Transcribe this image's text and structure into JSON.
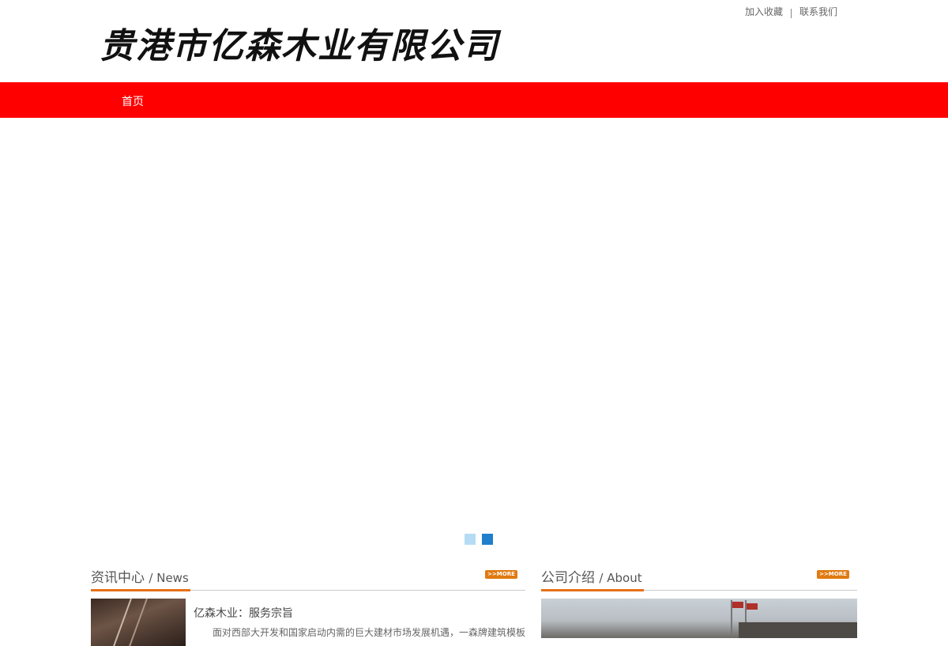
{
  "header": {
    "logo_text": "贵港市亿森木业有限公司",
    "links": {
      "favorite": "加入收藏",
      "contact": "联系我们"
    }
  },
  "nav": {
    "items": [
      "首页"
    ]
  },
  "banner": {
    "dot_colors": {
      "inactive": "#b6dcf5",
      "active": "#1f7fcc"
    }
  },
  "news": {
    "title_cn": "资讯中心",
    "title_en": "/ News",
    "more": ">>MORE",
    "items": [
      {
        "title": "亿森木业：服务宗旨",
        "desc": "面对西部大开发和国家启动内需的巨大建材市场发展机遇，一森牌建筑模板"
      }
    ]
  },
  "about": {
    "title_cn": "公司介绍",
    "title_en": "/ About",
    "more": ">>MORE"
  },
  "colors": {
    "nav_bg": "#ff0000",
    "accent": "#e8701a",
    "more_bg": "#e07a12"
  }
}
